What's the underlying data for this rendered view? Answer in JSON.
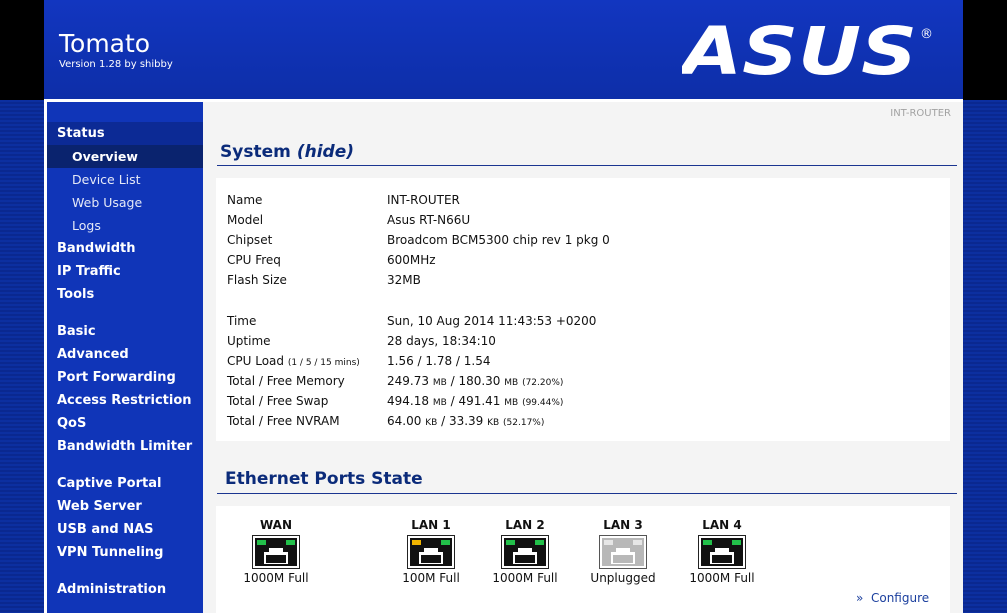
{
  "header": {
    "title": "Tomato",
    "version": "Version 1.28 by shibby",
    "brand": "ASUS"
  },
  "sidebar": {
    "groups": [
      {
        "label": "Status"
      },
      {
        "label": "Bandwidth"
      },
      {
        "label": "IP Traffic"
      },
      {
        "label": "Tools"
      },
      {
        "label": "Basic"
      },
      {
        "label": "Advanced"
      },
      {
        "label": "Port Forwarding"
      },
      {
        "label": "Access Restriction"
      },
      {
        "label": "QoS"
      },
      {
        "label": "Bandwidth Limiter"
      },
      {
        "label": "Captive Portal"
      },
      {
        "label": "Web Server"
      },
      {
        "label": "USB and NAS"
      },
      {
        "label": "VPN Tunneling"
      },
      {
        "label": "Administration"
      }
    ],
    "status_subitems": [
      {
        "label": "Overview"
      },
      {
        "label": "Device List"
      },
      {
        "label": "Web Usage"
      },
      {
        "label": "Logs"
      }
    ]
  },
  "main": {
    "router_name_tag": "INT-ROUTER",
    "system": {
      "title": "System",
      "hide_link": "(hide)",
      "rows": [
        {
          "label": "Name",
          "value": "INT-ROUTER"
        },
        {
          "label": "Model",
          "value": "Asus RT-N66U"
        },
        {
          "label": "Chipset",
          "value": "Broadcom BCM5300 chip rev 1 pkg 0"
        },
        {
          "label": "CPU Freq",
          "value": "600MHz"
        },
        {
          "label": "Flash Size",
          "value": "32MB"
        }
      ],
      "time": {
        "label": "Time",
        "value": "Sun, 10 Aug 2014 11:43:53 +0200"
      },
      "uptime": {
        "label": "Uptime",
        "value": "28 days, 18:34:10"
      },
      "cpu_load": {
        "label": "CPU Load",
        "label_note": "(1 / 5 / 15 mins)",
        "value": "1.56 / 1.78 / 1.54"
      },
      "memory": {
        "label": "Total / Free Memory",
        "total": "249.73",
        "free": "180.30",
        "unit": "MB",
        "pct": "(72.20%)"
      },
      "swap": {
        "label": "Total / Free Swap",
        "total": "494.18",
        "free": "491.41",
        "unit": "MB",
        "pct": "(99.44%)"
      },
      "nvram": {
        "label": "Total / Free NVRAM",
        "total": "64.00",
        "free": "33.39",
        "unit": "KB",
        "pct": "(52.17%)"
      }
    },
    "ethernet": {
      "title": "Ethernet Ports State",
      "ports": [
        {
          "name": "WAN",
          "status": "1000M Full",
          "state": "connected"
        },
        {
          "name": "LAN 1",
          "status": "100M Full",
          "state": "connected-100"
        },
        {
          "name": "LAN 2",
          "status": "1000M Full",
          "state": "connected"
        },
        {
          "name": "LAN 3",
          "status": "Unplugged",
          "state": "unplugged"
        },
        {
          "name": "LAN 4",
          "status": "1000M Full",
          "state": "connected"
        }
      ],
      "configure_label": "Configure",
      "configure_prefix": "»"
    }
  },
  "colors": {
    "header_bg": "#1236c0",
    "sidebar_bg": "#1035b8",
    "section_title": "#0b2b7a",
    "led_green": "#22c04a",
    "led_amber": "#f0b400",
    "led_off": "#b8b8b8"
  }
}
